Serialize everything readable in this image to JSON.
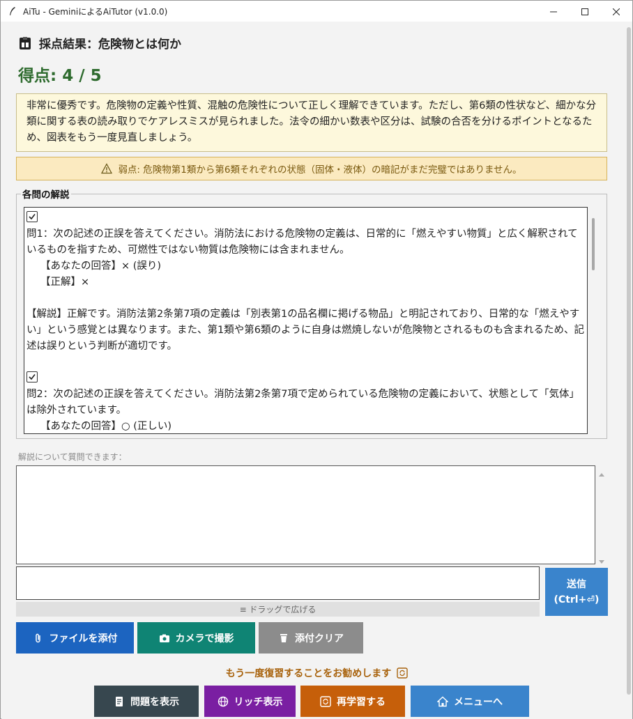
{
  "window": {
    "title": "AiTu - GeminiによるAiTutor (v1.0.0)",
    "minimize_icon": "minimize-icon",
    "maximize_icon": "maximize-icon",
    "close_icon": "close-icon"
  },
  "result": {
    "heading": "採点結果：危険物とは何か",
    "score": "得点: 4 / 5",
    "summary": "非常に優秀です。危険物の定義や性質、混触の危険性について正しく理解できています。ただし、第6類の性状など、細かな分類に関する表の読み取りでケアレスミスが見られました。法令の細かい数表や区分は、試験の合否を分けるポイントとなるため、図表をもう一度見直しましょう。",
    "weak_point": "弱点: 危険物第1類から第6類それぞれの状態（固体・液体）の暗記がまだ完璧ではありません。"
  },
  "explanations": {
    "legend": "各問の解説",
    "q1": {
      "question": "問1：次の記述の正誤を答えてください。消防法における危険物の定義は、日常的に「燃えやすい物質」と広く解釈されているものを指すため、可燃性ではない物質は危険物には含まれません。",
      "your_answer": "【あなたの回答】× (誤り)",
      "correct": "【正解】×",
      "commentary": "【解説】正解です。消防法第2条第7項の定義は「別表第1の品名欄に掲げる物品」と明記されており、日常的な「燃えやすい」という感覚とは異なります。また、第1類や第6類のように自身は燃焼しないが危険物とされるものも含まれるため、記述は誤りという判断が適切です。"
    },
    "q2": {
      "question": "問2：次の記述の正誤を答えてください。消防法第2条第7項で定められている危険物の定義において、状態として「気体」は除外されています。",
      "your_answer": "【あなたの回答】○ (正しい)"
    }
  },
  "chat": {
    "ask_label": "解説について質問できます：",
    "drag_hint": "≡ ドラッグで広げる",
    "send_line1": "送信",
    "send_line2": "(Ctrl+⏎)"
  },
  "attach_buttons": {
    "file": "ファイルを添付",
    "camera": "カメラで撮影",
    "clear": "添付クリア"
  },
  "recommend": "もう一度復習することをお勧めします",
  "bottom_buttons": {
    "show_questions": "問題を表示",
    "rich_view": "リッチ表示",
    "relearn": "再学習する",
    "menu": "メニューへ"
  },
  "colors": {
    "score_green": "#2e6b2e",
    "send_blue": "#3a84cc",
    "file_blue": "#1c64c0",
    "camera_teal": "#0f8474",
    "clear_gray": "#8c8c8c",
    "dark_slate": "#37474f",
    "rich_purple": "#7a1fa2",
    "relearn_orange": "#c65f0a",
    "menu_blue": "#3a84cc"
  }
}
